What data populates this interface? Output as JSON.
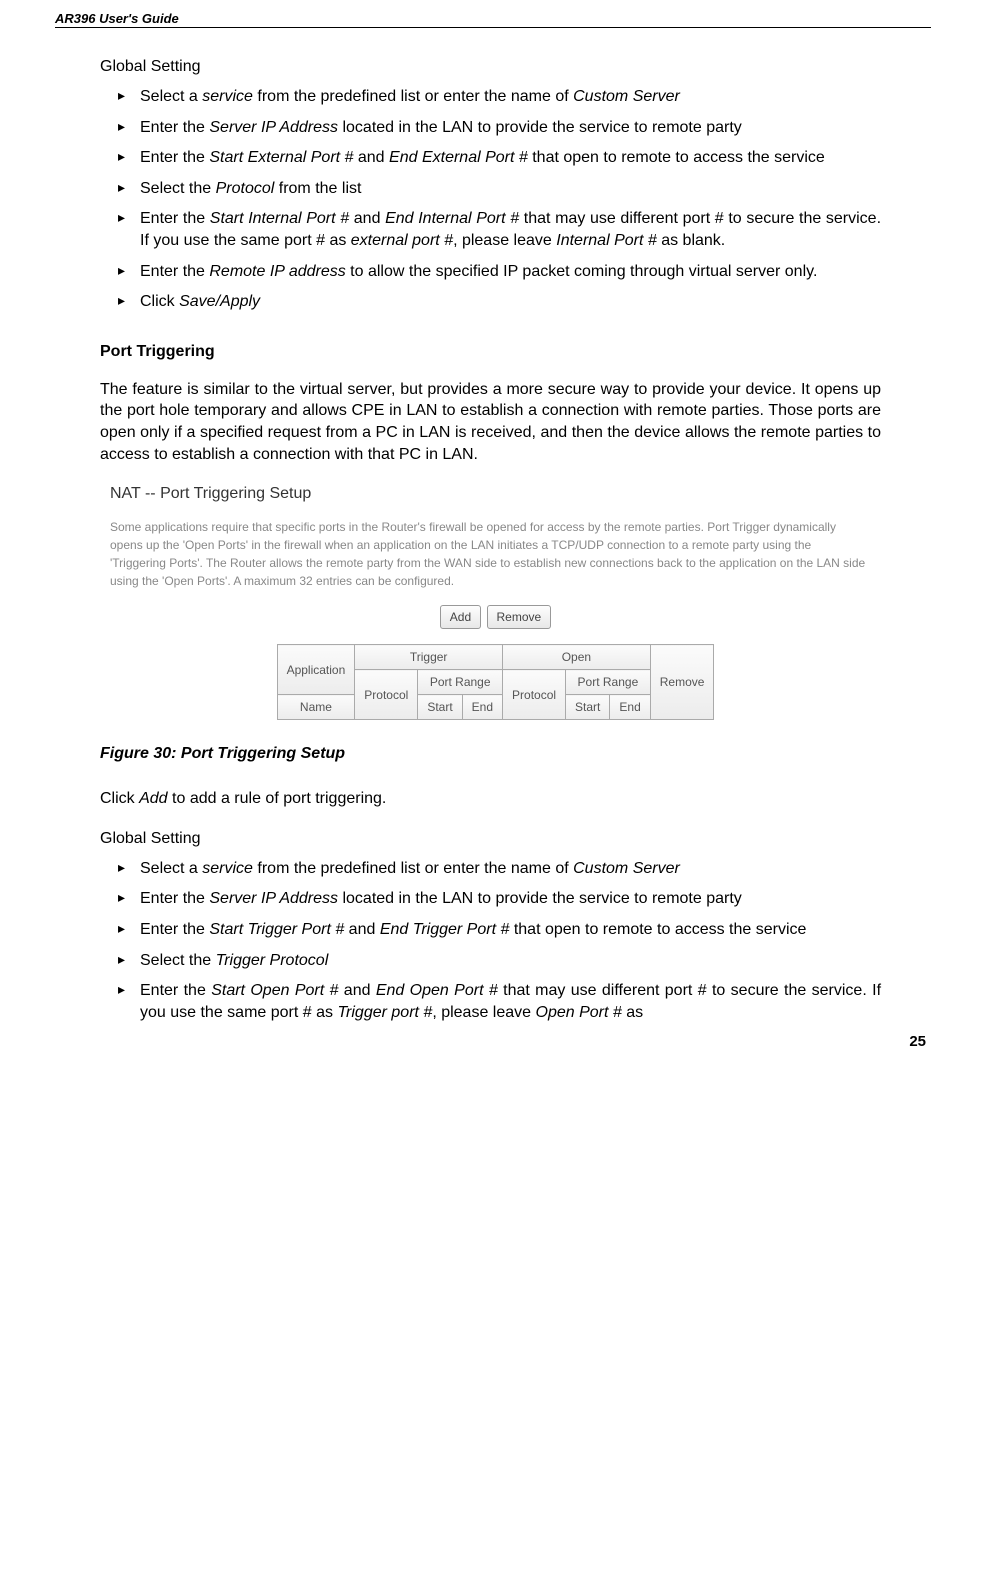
{
  "header": {
    "guide_title": "AR396 User's Guide"
  },
  "section1": {
    "label": "Global Setting",
    "bullets": [
      {
        "pre": "Select a ",
        "i1": "service",
        "mid": " from the predefined list or enter the name of ",
        "i2": "Custom Server",
        "post": ""
      },
      {
        "pre": "Enter the ",
        "i1": "Server IP Address",
        "mid": " located in the LAN to provide the service to remote party",
        "i2": "",
        "post": ""
      },
      {
        "pre": "Enter the ",
        "i1": "Start External Port #",
        "mid": " and ",
        "i2": "End External Port #",
        "post": " that open to remote to access the service"
      },
      {
        "pre": "Select the ",
        "i1": "Protocol",
        "mid": " from the list",
        "i2": "",
        "post": ""
      },
      {
        "pre": "Enter the ",
        "i1": "Start Internal Port #",
        "mid": " and ",
        "i2": "End Internal Port #",
        "post": " that may use different port # to secure the service. If you use the same port # as ",
        "i3": "external port #",
        "post2": ", please leave ",
        "i4": "Internal Port #",
        "post3": " as blank."
      },
      {
        "pre": "Enter the ",
        "i1": "Remote IP address",
        "mid": " to allow the specified IP packet coming through virtual server only.",
        "i2": "",
        "post": ""
      },
      {
        "pre": "Click ",
        "i1": "Save/Apply",
        "mid": "",
        "i2": "",
        "post": ""
      }
    ]
  },
  "port_triggering": {
    "heading": "Port Triggering",
    "description": "The feature is similar to the virtual server, but provides a more secure way to provide your device. It opens up the port hole temporary and allows CPE in LAN to establish a connection with remote parties. Those ports are open only if a specified request from a PC in LAN is received, and then the device allows the remote parties to access to establish a connection with that PC in LAN."
  },
  "screenshot": {
    "title": "NAT -- Port Triggering Setup",
    "desc": "Some applications require that specific ports in the Router's firewall be opened for access by the remote parties. Port Trigger dynamically opens up the 'Open Ports' in the firewall when an application on the LAN initiates a TCP/UDP connection to a remote party using the 'Triggering Ports'. The Router allows the remote party from the WAN side to establish new connections back to the application on the LAN side using the 'Open Ports'. A maximum 32 entries can be configured.",
    "add_btn": "Add",
    "remove_btn": "Remove",
    "table": {
      "h_app": "Application",
      "h_trigger": "Trigger",
      "h_open": "Open",
      "h_remove": "Remove",
      "h_name": "Name",
      "h_protocol": "Protocol",
      "h_portrange": "Port Range",
      "h_start": "Start",
      "h_end": "End"
    }
  },
  "figure_caption": "Figure 30: Port Triggering Setup",
  "click_add": {
    "pre": "Click ",
    "i1": "Add",
    "post": " to add a rule of port triggering."
  },
  "section2": {
    "label": "Global Setting",
    "bullets": [
      {
        "pre": "Select a ",
        "i1": "service",
        "mid": " from the predefined list or enter the name of ",
        "i2": "Custom Server",
        "post": ""
      },
      {
        "pre": "Enter the ",
        "i1": "Server IP Address",
        "mid": " located in the LAN to provide the service to remote party",
        "i2": "",
        "post": ""
      },
      {
        "pre": "Enter the ",
        "i1": "Start Trigger Port #",
        "mid": " and ",
        "i2": "End Trigger Port #",
        "post": " that open to remote to access the service"
      },
      {
        "pre": "Select the ",
        "i1": "Trigger Protocol",
        "mid": "",
        "i2": "",
        "post": ""
      },
      {
        "pre": "Enter the ",
        "i1": "Start Open Port #",
        "mid": " and ",
        "i2": "End Open Port #",
        "post": " that may use different port # to secure the service. If you use the same port # as ",
        "i3": "Trigger port #",
        "post2": ", please leave ",
        "i4": "Open Port #",
        "post3": " as"
      }
    ]
  },
  "page_number": "25"
}
